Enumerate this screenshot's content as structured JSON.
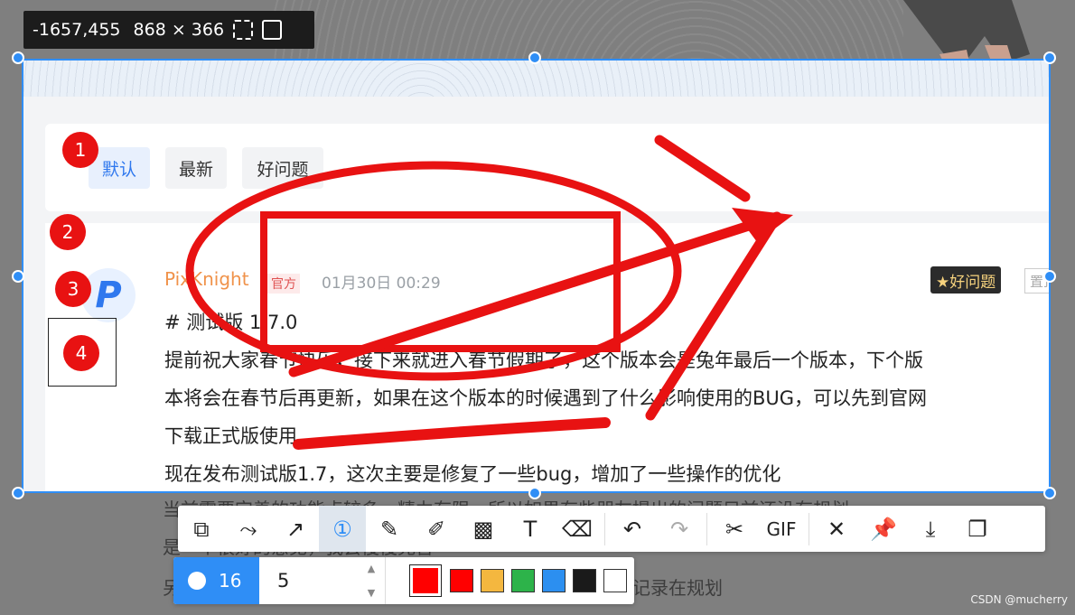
{
  "info_bar": {
    "coords": "-1657,455",
    "size": "868 × 366"
  },
  "tabs": [
    "默认",
    "最新",
    "好问题"
  ],
  "post": {
    "avatar_letter": "P",
    "author": "PixKnight",
    "official": "官方",
    "time": "01月30日 00:29",
    "badge": "★好问题",
    "pin": "置顶",
    "title": "# 测试版 1.7.0",
    "lines": [
      "提前祝大家春节快乐，接下来就进入春节假期了，这个版本会是兔年最后一个版本，下个版",
      "本将会在春节后再更新，如果在这个版本的时候遇到了什么影响使用的BUG，可以先到官网",
      "下载正式版使用",
      "现在发布测试版1.7，这次主要是修复了一些bug，增加了一些操作的优化"
    ]
  },
  "background": {
    "lines": [
      "当前需要完善的功能点较多，精力有限，所以如果有些朋友提出的问题目前还没有规划",
      "是一个很好的意见，我会慢慢完善",
      "另外，大家提出的意见建议，但我都会看的，好的功能都会记录在规划"
    ]
  },
  "annotations": {
    "badges": [
      "1",
      "2",
      "3",
      "4"
    ]
  },
  "toolbar": {
    "tools": [
      {
        "name": "shape-tool-icon",
        "glyph": "⧉"
      },
      {
        "name": "polyline-tool-icon",
        "glyph": "⤳"
      },
      {
        "name": "arrow-tool-icon",
        "glyph": "↗"
      },
      {
        "name": "serial-number-tool-icon",
        "glyph": "①",
        "active": true
      },
      {
        "name": "pen-tool-icon",
        "glyph": "✎"
      },
      {
        "name": "marker-tool-icon",
        "glyph": "✐"
      },
      {
        "name": "mosaic-tool-icon",
        "glyph": "▩"
      },
      {
        "name": "text-tool-icon",
        "glyph": "T"
      },
      {
        "name": "eraser-tool-icon",
        "glyph": "⌫"
      },
      {
        "sep": true
      },
      {
        "name": "undo-icon",
        "glyph": "↶"
      },
      {
        "name": "redo-icon",
        "glyph": "↷",
        "disabled": true
      },
      {
        "sep": true
      },
      {
        "name": "scissors-icon",
        "glyph": "✂"
      },
      {
        "name": "gif-icon",
        "glyph": "GIF"
      },
      {
        "sep": true
      },
      {
        "name": "close-icon",
        "glyph": "✕"
      },
      {
        "name": "pin-icon",
        "glyph": "📌"
      },
      {
        "name": "download-icon",
        "glyph": "⤓"
      },
      {
        "name": "copy-icon",
        "glyph": "❐"
      }
    ]
  },
  "subbar": {
    "size_label": "16",
    "number_value": "5",
    "selected_color": "#ff0000",
    "colors": [
      "#ff0000",
      "#f4b73f",
      "#2db34a",
      "#2c8ff0",
      "#1a1a1a",
      "#ffffff"
    ]
  },
  "watermark": "CSDN @mucherry",
  "accent": "#2f8ef6",
  "annotation_color": "#e81212"
}
